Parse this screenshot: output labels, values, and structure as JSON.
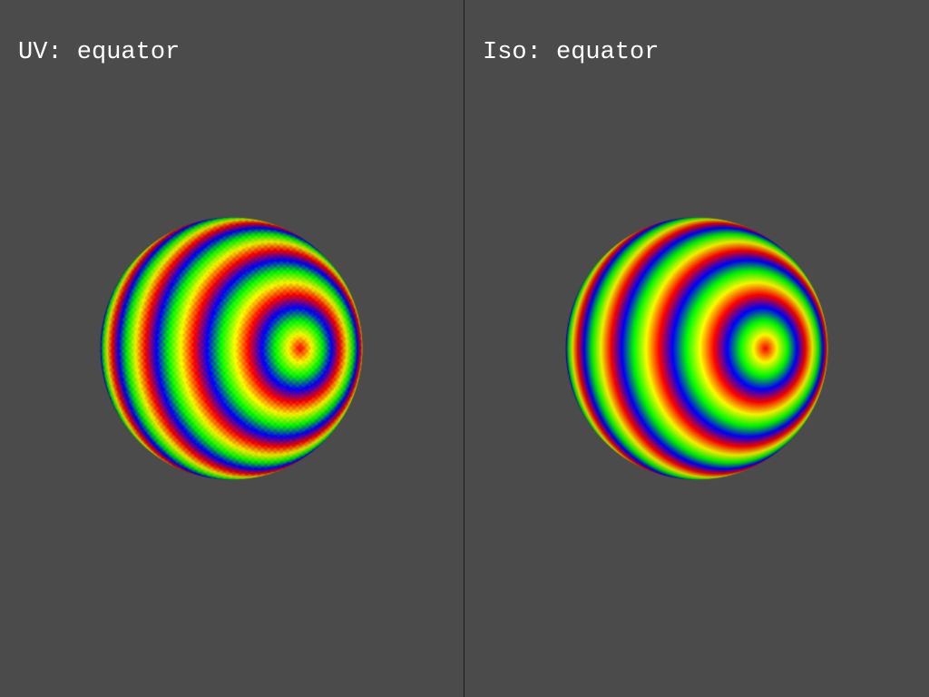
{
  "viewports": [
    {
      "label": "UV: equator",
      "mesh": "uv-sphere",
      "ring_center": {
        "u": 0.75,
        "v": 0.5
      }
    },
    {
      "label": "Iso: equator",
      "mesh": "iso-sphere",
      "ring_center": {
        "u": 0.75,
        "v": 0.5
      }
    }
  ],
  "colors": {
    "background": "#4b4b4b",
    "divider": "#1e1e1e",
    "label": "#ffffff",
    "ring_palette": [
      "#ff0000",
      "#ffff00",
      "#00ff00",
      "#0000ff"
    ]
  }
}
